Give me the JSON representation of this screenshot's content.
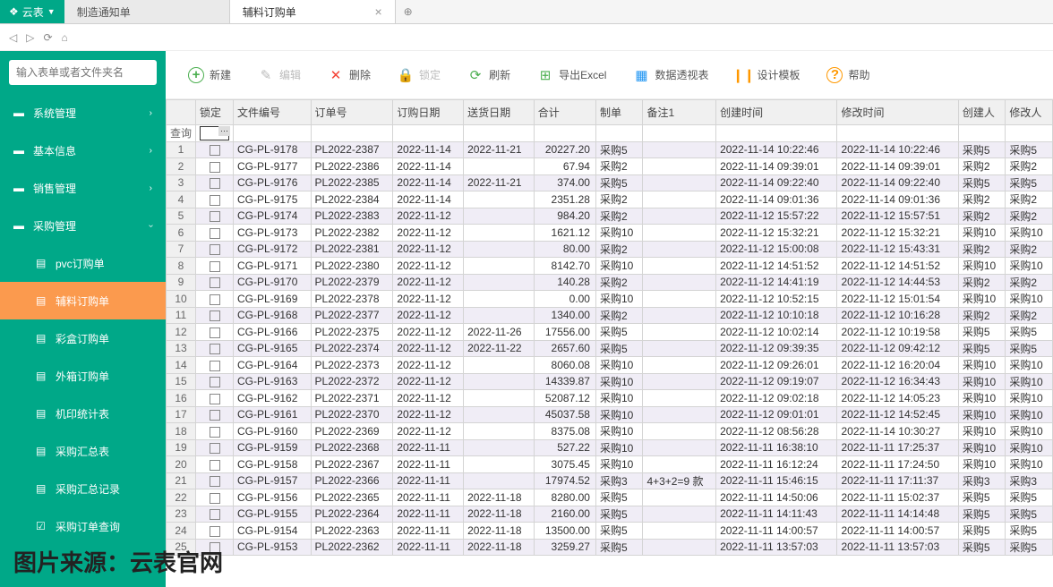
{
  "app": {
    "name": "云表"
  },
  "tabs": [
    {
      "label": "制造通知单",
      "active": false
    },
    {
      "label": "辅料订购单",
      "active": true
    }
  ],
  "search": {
    "placeholder": "输入表单或者文件夹名"
  },
  "menu": [
    {
      "label": "系统管理",
      "icon": "folder",
      "chev": true
    },
    {
      "label": "基本信息",
      "icon": "folder",
      "chev": true
    },
    {
      "label": "销售管理",
      "icon": "folder",
      "chev": true
    },
    {
      "label": "采购管理",
      "icon": "folder",
      "chev": true,
      "expanded": true
    },
    {
      "label": "pvc订购单",
      "icon": "doc",
      "sub": true
    },
    {
      "label": "辅料订购单",
      "icon": "doc",
      "sub": true,
      "active": true
    },
    {
      "label": "彩盒订购单",
      "icon": "doc",
      "sub": true
    },
    {
      "label": "外箱订购单",
      "icon": "doc",
      "sub": true
    },
    {
      "label": "机印统计表",
      "icon": "doc",
      "sub": true
    },
    {
      "label": "采购汇总表",
      "icon": "doc",
      "sub": true
    },
    {
      "label": "采购汇总记录",
      "icon": "doc",
      "sub": true
    },
    {
      "label": "采购订单查询",
      "icon": "check",
      "sub": true
    }
  ],
  "toolbar": [
    {
      "key": "new",
      "label": "新建",
      "icon": "ic-new",
      "glyph": "+"
    },
    {
      "key": "edit",
      "label": "编辑",
      "icon": "ic-edit",
      "glyph": "✎",
      "disabled": true
    },
    {
      "key": "delete",
      "label": "删除",
      "icon": "ic-del",
      "glyph": "✕"
    },
    {
      "key": "lock",
      "label": "锁定",
      "icon": "ic-lock",
      "glyph": "🔒",
      "disabled": true
    },
    {
      "key": "refresh",
      "label": "刷新",
      "icon": "ic-refresh",
      "glyph": "⟳"
    },
    {
      "key": "excel",
      "label": "导出Excel",
      "icon": "ic-excel",
      "glyph": "⊞"
    },
    {
      "key": "pivot",
      "label": "数据透视表",
      "icon": "ic-pivot",
      "glyph": "▦"
    },
    {
      "key": "design",
      "label": "设计模板",
      "icon": "ic-design",
      "glyph": "❙❙"
    },
    {
      "key": "help",
      "label": "帮助",
      "icon": "ic-help",
      "glyph": "?"
    }
  ],
  "columns": [
    "",
    "锁定",
    "文件编号",
    "订单号",
    "订购日期",
    "送货日期",
    "合计",
    "制单",
    "备注1",
    "创建时间",
    "修改时间",
    "创建人",
    "修改人"
  ],
  "filterLabel": "查询",
  "rows": [
    {
      "n": 1,
      "f": "CG-PL-9178",
      "o": "PL2022-2387",
      "d1": "2022-11-14",
      "d2": "2022-11-21",
      "t": "20227.20",
      "m": "采购5",
      "r": "",
      "c": "2022-11-14 10:22:46",
      "u": "2022-11-14 10:22:46",
      "cp": "采购5",
      "up": "采购5"
    },
    {
      "n": 2,
      "f": "CG-PL-9177",
      "o": "PL2022-2386",
      "d1": "2022-11-14",
      "d2": "",
      "t": "67.94",
      "m": "采购2",
      "r": "",
      "c": "2022-11-14 09:39:01",
      "u": "2022-11-14 09:39:01",
      "cp": "采购2",
      "up": "采购2"
    },
    {
      "n": 3,
      "f": "CG-PL-9176",
      "o": "PL2022-2385",
      "d1": "2022-11-14",
      "d2": "2022-11-21",
      "t": "374.00",
      "m": "采购5",
      "r": "",
      "c": "2022-11-14 09:22:40",
      "u": "2022-11-14 09:22:40",
      "cp": "采购5",
      "up": "采购5"
    },
    {
      "n": 4,
      "f": "CG-PL-9175",
      "o": "PL2022-2384",
      "d1": "2022-11-14",
      "d2": "",
      "t": "2351.28",
      "m": "采购2",
      "r": "",
      "c": "2022-11-14 09:01:36",
      "u": "2022-11-14 09:01:36",
      "cp": "采购2",
      "up": "采购2"
    },
    {
      "n": 5,
      "f": "CG-PL-9174",
      "o": "PL2022-2383",
      "d1": "2022-11-12",
      "d2": "",
      "t": "984.20",
      "m": "采购2",
      "r": "",
      "c": "2022-11-12 15:57:22",
      "u": "2022-11-12 15:57:51",
      "cp": "采购2",
      "up": "采购2"
    },
    {
      "n": 6,
      "f": "CG-PL-9173",
      "o": "PL2022-2382",
      "d1": "2022-11-12",
      "d2": "",
      "t": "1621.12",
      "m": "采购10",
      "r": "",
      "c": "2022-11-12 15:32:21",
      "u": "2022-11-12 15:32:21",
      "cp": "采购10",
      "up": "采购10"
    },
    {
      "n": 7,
      "f": "CG-PL-9172",
      "o": "PL2022-2381",
      "d1": "2022-11-12",
      "d2": "",
      "t": "80.00",
      "m": "采购2",
      "r": "",
      "c": "2022-11-12 15:00:08",
      "u": "2022-11-12 15:43:31",
      "cp": "采购2",
      "up": "采购2"
    },
    {
      "n": 8,
      "f": "CG-PL-9171",
      "o": "PL2022-2380",
      "d1": "2022-11-12",
      "d2": "",
      "t": "8142.70",
      "m": "采购10",
      "r": "",
      "c": "2022-11-12 14:51:52",
      "u": "2022-11-12 14:51:52",
      "cp": "采购10",
      "up": "采购10"
    },
    {
      "n": 9,
      "f": "CG-PL-9170",
      "o": "PL2022-2379",
      "d1": "2022-11-12",
      "d2": "",
      "t": "140.28",
      "m": "采购2",
      "r": "",
      "c": "2022-11-12 14:41:19",
      "u": "2022-11-12 14:44:53",
      "cp": "采购2",
      "up": "采购2"
    },
    {
      "n": 10,
      "f": "CG-PL-9169",
      "o": "PL2022-2378",
      "d1": "2022-11-12",
      "d2": "",
      "t": "0.00",
      "m": "采购10",
      "r": "",
      "c": "2022-11-12 10:52:15",
      "u": "2022-11-12 15:01:54",
      "cp": "采购10",
      "up": "采购10"
    },
    {
      "n": 11,
      "f": "CG-PL-9168",
      "o": "PL2022-2377",
      "d1": "2022-11-12",
      "d2": "",
      "t": "1340.00",
      "m": "采购2",
      "r": "",
      "c": "2022-11-12 10:10:18",
      "u": "2022-11-12 10:16:28",
      "cp": "采购2",
      "up": "采购2"
    },
    {
      "n": 12,
      "f": "CG-PL-9166",
      "o": "PL2022-2375",
      "d1": "2022-11-12",
      "d2": "2022-11-26",
      "t": "17556.00",
      "m": "采购5",
      "r": "",
      "c": "2022-11-12 10:02:14",
      "u": "2022-11-12 10:19:58",
      "cp": "采购5",
      "up": "采购5"
    },
    {
      "n": 13,
      "f": "CG-PL-9165",
      "o": "PL2022-2374",
      "d1": "2022-11-12",
      "d2": "2022-11-22",
      "t": "2657.60",
      "m": "采购5",
      "r": "",
      "c": "2022-11-12 09:39:35",
      "u": "2022-11-12 09:42:12",
      "cp": "采购5",
      "up": "采购5"
    },
    {
      "n": 14,
      "f": "CG-PL-9164",
      "o": "PL2022-2373",
      "d1": "2022-11-12",
      "d2": "",
      "t": "8060.08",
      "m": "采购10",
      "r": "",
      "c": "2022-11-12 09:26:01",
      "u": "2022-11-12 16:20:04",
      "cp": "采购10",
      "up": "采购10"
    },
    {
      "n": 15,
      "f": "CG-PL-9163",
      "o": "PL2022-2372",
      "d1": "2022-11-12",
      "d2": "",
      "t": "14339.87",
      "m": "采购10",
      "r": "",
      "c": "2022-11-12 09:19:07",
      "u": "2022-11-12 16:34:43",
      "cp": "采购10",
      "up": "采购10"
    },
    {
      "n": 16,
      "f": "CG-PL-9162",
      "o": "PL2022-2371",
      "d1": "2022-11-12",
      "d2": "",
      "t": "52087.12",
      "m": "采购10",
      "r": "",
      "c": "2022-11-12 09:02:18",
      "u": "2022-11-12 14:05:23",
      "cp": "采购10",
      "up": "采购10"
    },
    {
      "n": 17,
      "f": "CG-PL-9161",
      "o": "PL2022-2370",
      "d1": "2022-11-12",
      "d2": "",
      "t": "45037.58",
      "m": "采购10",
      "r": "",
      "c": "2022-11-12 09:01:01",
      "u": "2022-11-12 14:52:45",
      "cp": "采购10",
      "up": "采购10"
    },
    {
      "n": 18,
      "f": "CG-PL-9160",
      "o": "PL2022-2369",
      "d1": "2022-11-12",
      "d2": "",
      "t": "8375.08",
      "m": "采购10",
      "r": "",
      "c": "2022-11-12 08:56:28",
      "u": "2022-11-14 10:30:27",
      "cp": "采购10",
      "up": "采购10"
    },
    {
      "n": 19,
      "f": "CG-PL-9159",
      "o": "PL2022-2368",
      "d1": "2022-11-11",
      "d2": "",
      "t": "527.22",
      "m": "采购10",
      "r": "",
      "c": "2022-11-11 16:38:10",
      "u": "2022-11-11 17:25:37",
      "cp": "采购10",
      "up": "采购10"
    },
    {
      "n": 20,
      "f": "CG-PL-9158",
      "o": "PL2022-2367",
      "d1": "2022-11-11",
      "d2": "",
      "t": "3075.45",
      "m": "采购10",
      "r": "",
      "c": "2022-11-11 16:12:24",
      "u": "2022-11-11 17:24:50",
      "cp": "采购10",
      "up": "采购10"
    },
    {
      "n": 21,
      "f": "CG-PL-9157",
      "o": "PL2022-2366",
      "d1": "2022-11-11",
      "d2": "",
      "t": "17974.52",
      "m": "采购3",
      "r": "4+3+2=9 款",
      "c": "2022-11-11 15:46:15",
      "u": "2022-11-11 17:11:37",
      "cp": "采购3",
      "up": "采购3"
    },
    {
      "n": 22,
      "f": "CG-PL-9156",
      "o": "PL2022-2365",
      "d1": "2022-11-11",
      "d2": "2022-11-18",
      "t": "8280.00",
      "m": "采购5",
      "r": "",
      "c": "2022-11-11 14:50:06",
      "u": "2022-11-11 15:02:37",
      "cp": "采购5",
      "up": "采购5"
    },
    {
      "n": 23,
      "f": "CG-PL-9155",
      "o": "PL2022-2364",
      "d1": "2022-11-11",
      "d2": "2022-11-18",
      "t": "2160.00",
      "m": "采购5",
      "r": "",
      "c": "2022-11-11 14:11:43",
      "u": "2022-11-11 14:14:48",
      "cp": "采购5",
      "up": "采购5"
    },
    {
      "n": 24,
      "f": "CG-PL-9154",
      "o": "PL2022-2363",
      "d1": "2022-11-11",
      "d2": "2022-11-18",
      "t": "13500.00",
      "m": "采购5",
      "r": "",
      "c": "2022-11-11 14:00:57",
      "u": "2022-11-11 14:00:57",
      "cp": "采购5",
      "up": "采购5"
    },
    {
      "n": 25,
      "f": "CG-PL-9153",
      "o": "PL2022-2362",
      "d1": "2022-11-11",
      "d2": "2022-11-18",
      "t": "3259.27",
      "m": "采购5",
      "r": "",
      "c": "2022-11-11 13:57:03",
      "u": "2022-11-11 13:57:03",
      "cp": "采购5",
      "up": "采购5"
    }
  ],
  "watermark": "图片来源：云表官网"
}
